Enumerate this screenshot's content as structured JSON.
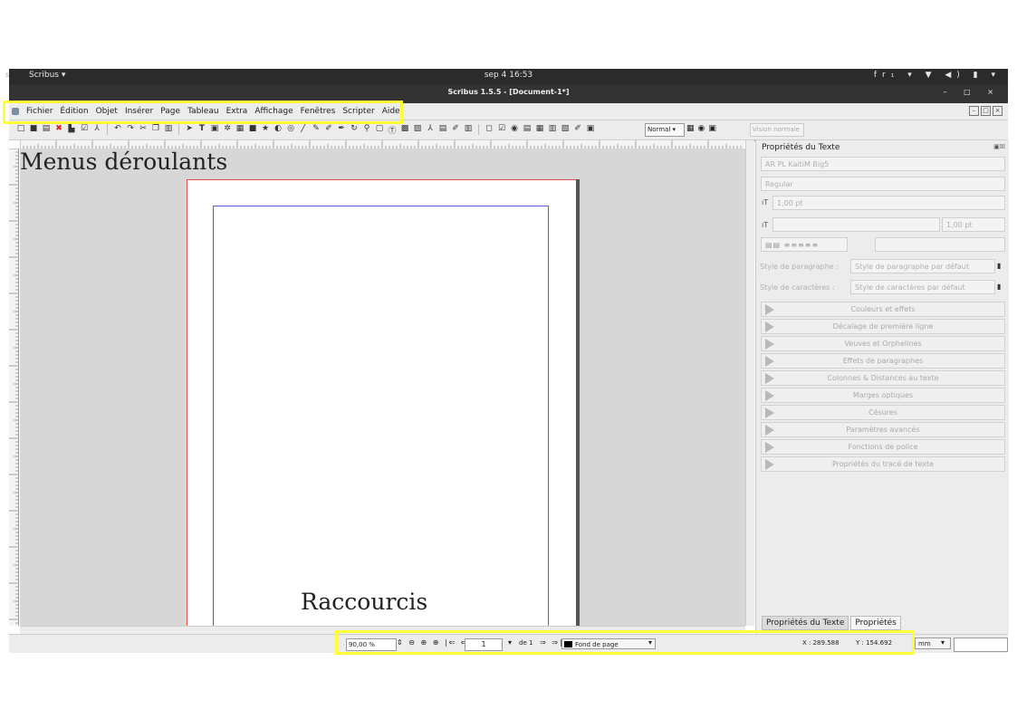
{
  "topbar": {
    "edge": "s",
    "app_menu": "Scribus ▾",
    "clock": "sep 4  16:53",
    "tray": "fr₁ ▾   ▼ ◀) ▮ ▾"
  },
  "window": {
    "title": "Scribus 1.5.5 - [Document-1*]",
    "controls": "–  □  ×"
  },
  "menubar": {
    "items": [
      "Fichier",
      "Édition",
      "Objet",
      "Insérer",
      "Page",
      "Tableau",
      "Extra",
      "Affichage",
      "Fenêtres",
      "Scripter",
      "Aide"
    ]
  },
  "toolbar": {
    "mode": "Normal",
    "preview": "Vision normale"
  },
  "canvas": {
    "text_menus": "Menus déroulants",
    "text_shortcuts": "Raccourcis"
  },
  "properties": {
    "title": "Propriétés du Texte",
    "font": "AR PL KaitiM Big5",
    "style": "Regular",
    "size": "1,00 pt",
    "spacing": "1,00 pt",
    "para_style_label": "Style de paragraphe :",
    "para_style_value": "Style de paragraphe par défaut",
    "char_style_label": "Style de caractères :",
    "char_style_value": "Style de caractères par défaut",
    "sections": [
      "Couleurs et effets",
      "Décalage de première ligne",
      "Veuves et Orphelines",
      "Effets de paragraphes",
      "Colonnes & Distances au texte",
      "Marges optiques",
      "Césures",
      "Paramètres avancés",
      "Fonctions de police",
      "Propriétés du tracé de texte"
    ],
    "tabs": [
      "Propriétés du Texte",
      "Propriétés"
    ]
  },
  "statusbar": {
    "zoom": "90,00 %",
    "page": "1",
    "page_count": "de 1",
    "layer": "Fond de page",
    "x": "X : 289.588",
    "y": "Y : 154.692",
    "unit": "mm"
  },
  "highlight_color": "#ffff33"
}
